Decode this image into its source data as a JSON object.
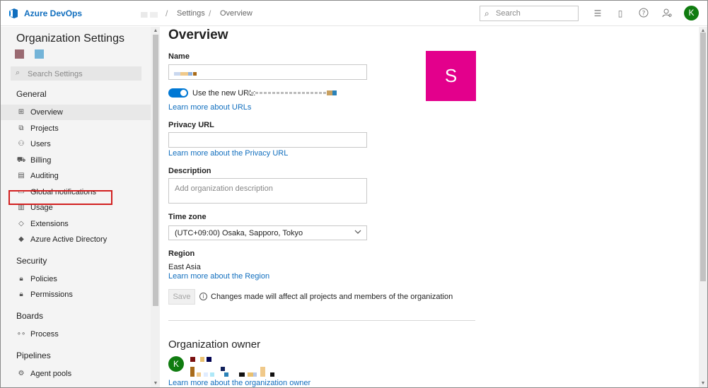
{
  "header": {
    "brand": "Azure DevOps",
    "breadcrumbs": [
      "Settings",
      "Overview"
    ],
    "separator": "/",
    "search_placeholder": "Search",
    "user_initial": "K",
    "icons": [
      "list-icon",
      "shopping-bag-icon",
      "help-icon",
      "user-settings-icon"
    ]
  },
  "sidebar": {
    "title": "Organization Settings",
    "search_placeholder": "Search Settings",
    "sections": {
      "general": "General",
      "security": "Security",
      "boards": "Boards",
      "pipelines": "Pipelines"
    },
    "items": {
      "overview": "Overview",
      "projects": "Projects",
      "users": "Users",
      "billing": "Billing",
      "auditing": "Auditing",
      "global_notifications": "Global notifications",
      "usage": "Usage",
      "extensions": "Extensions",
      "azure_ad": "Azure Active Directory",
      "policies": "Policies",
      "permissions": "Permissions",
      "process": "Process",
      "agent_pools": "Agent pools"
    },
    "active_item": "Overview",
    "highlighted_item": "Extensions"
  },
  "main": {
    "title": "Overview",
    "name_label": "Name",
    "new_url_label": "Use the new URL:",
    "new_url_enabled": true,
    "learn_urls": "Learn more about URLs",
    "privacy_label": "Privacy URL",
    "learn_privacy": "Learn more about the Privacy URL",
    "description_label": "Description",
    "description_placeholder": "Add organization description",
    "timezone_label": "Time zone",
    "timezone_value": "(UTC+09:00) Osaka, Sapporo, Tokyo",
    "region_label": "Region",
    "region_value": "East Asia",
    "learn_region": "Learn more about the Region",
    "save_label": "Save",
    "info_text": "Changes made will affect all projects and members of the organization",
    "org_avatar_letter": "S",
    "owner_title": "Organization owner",
    "owner_initial": "K",
    "learn_owner": "Learn more about the organization owner"
  },
  "colors": {
    "accent": "#0078d4",
    "link": "#106ebe",
    "org_avatar": "#e3008c",
    "user_avatar": "#107c10",
    "highlight_box": "#d22020"
  }
}
